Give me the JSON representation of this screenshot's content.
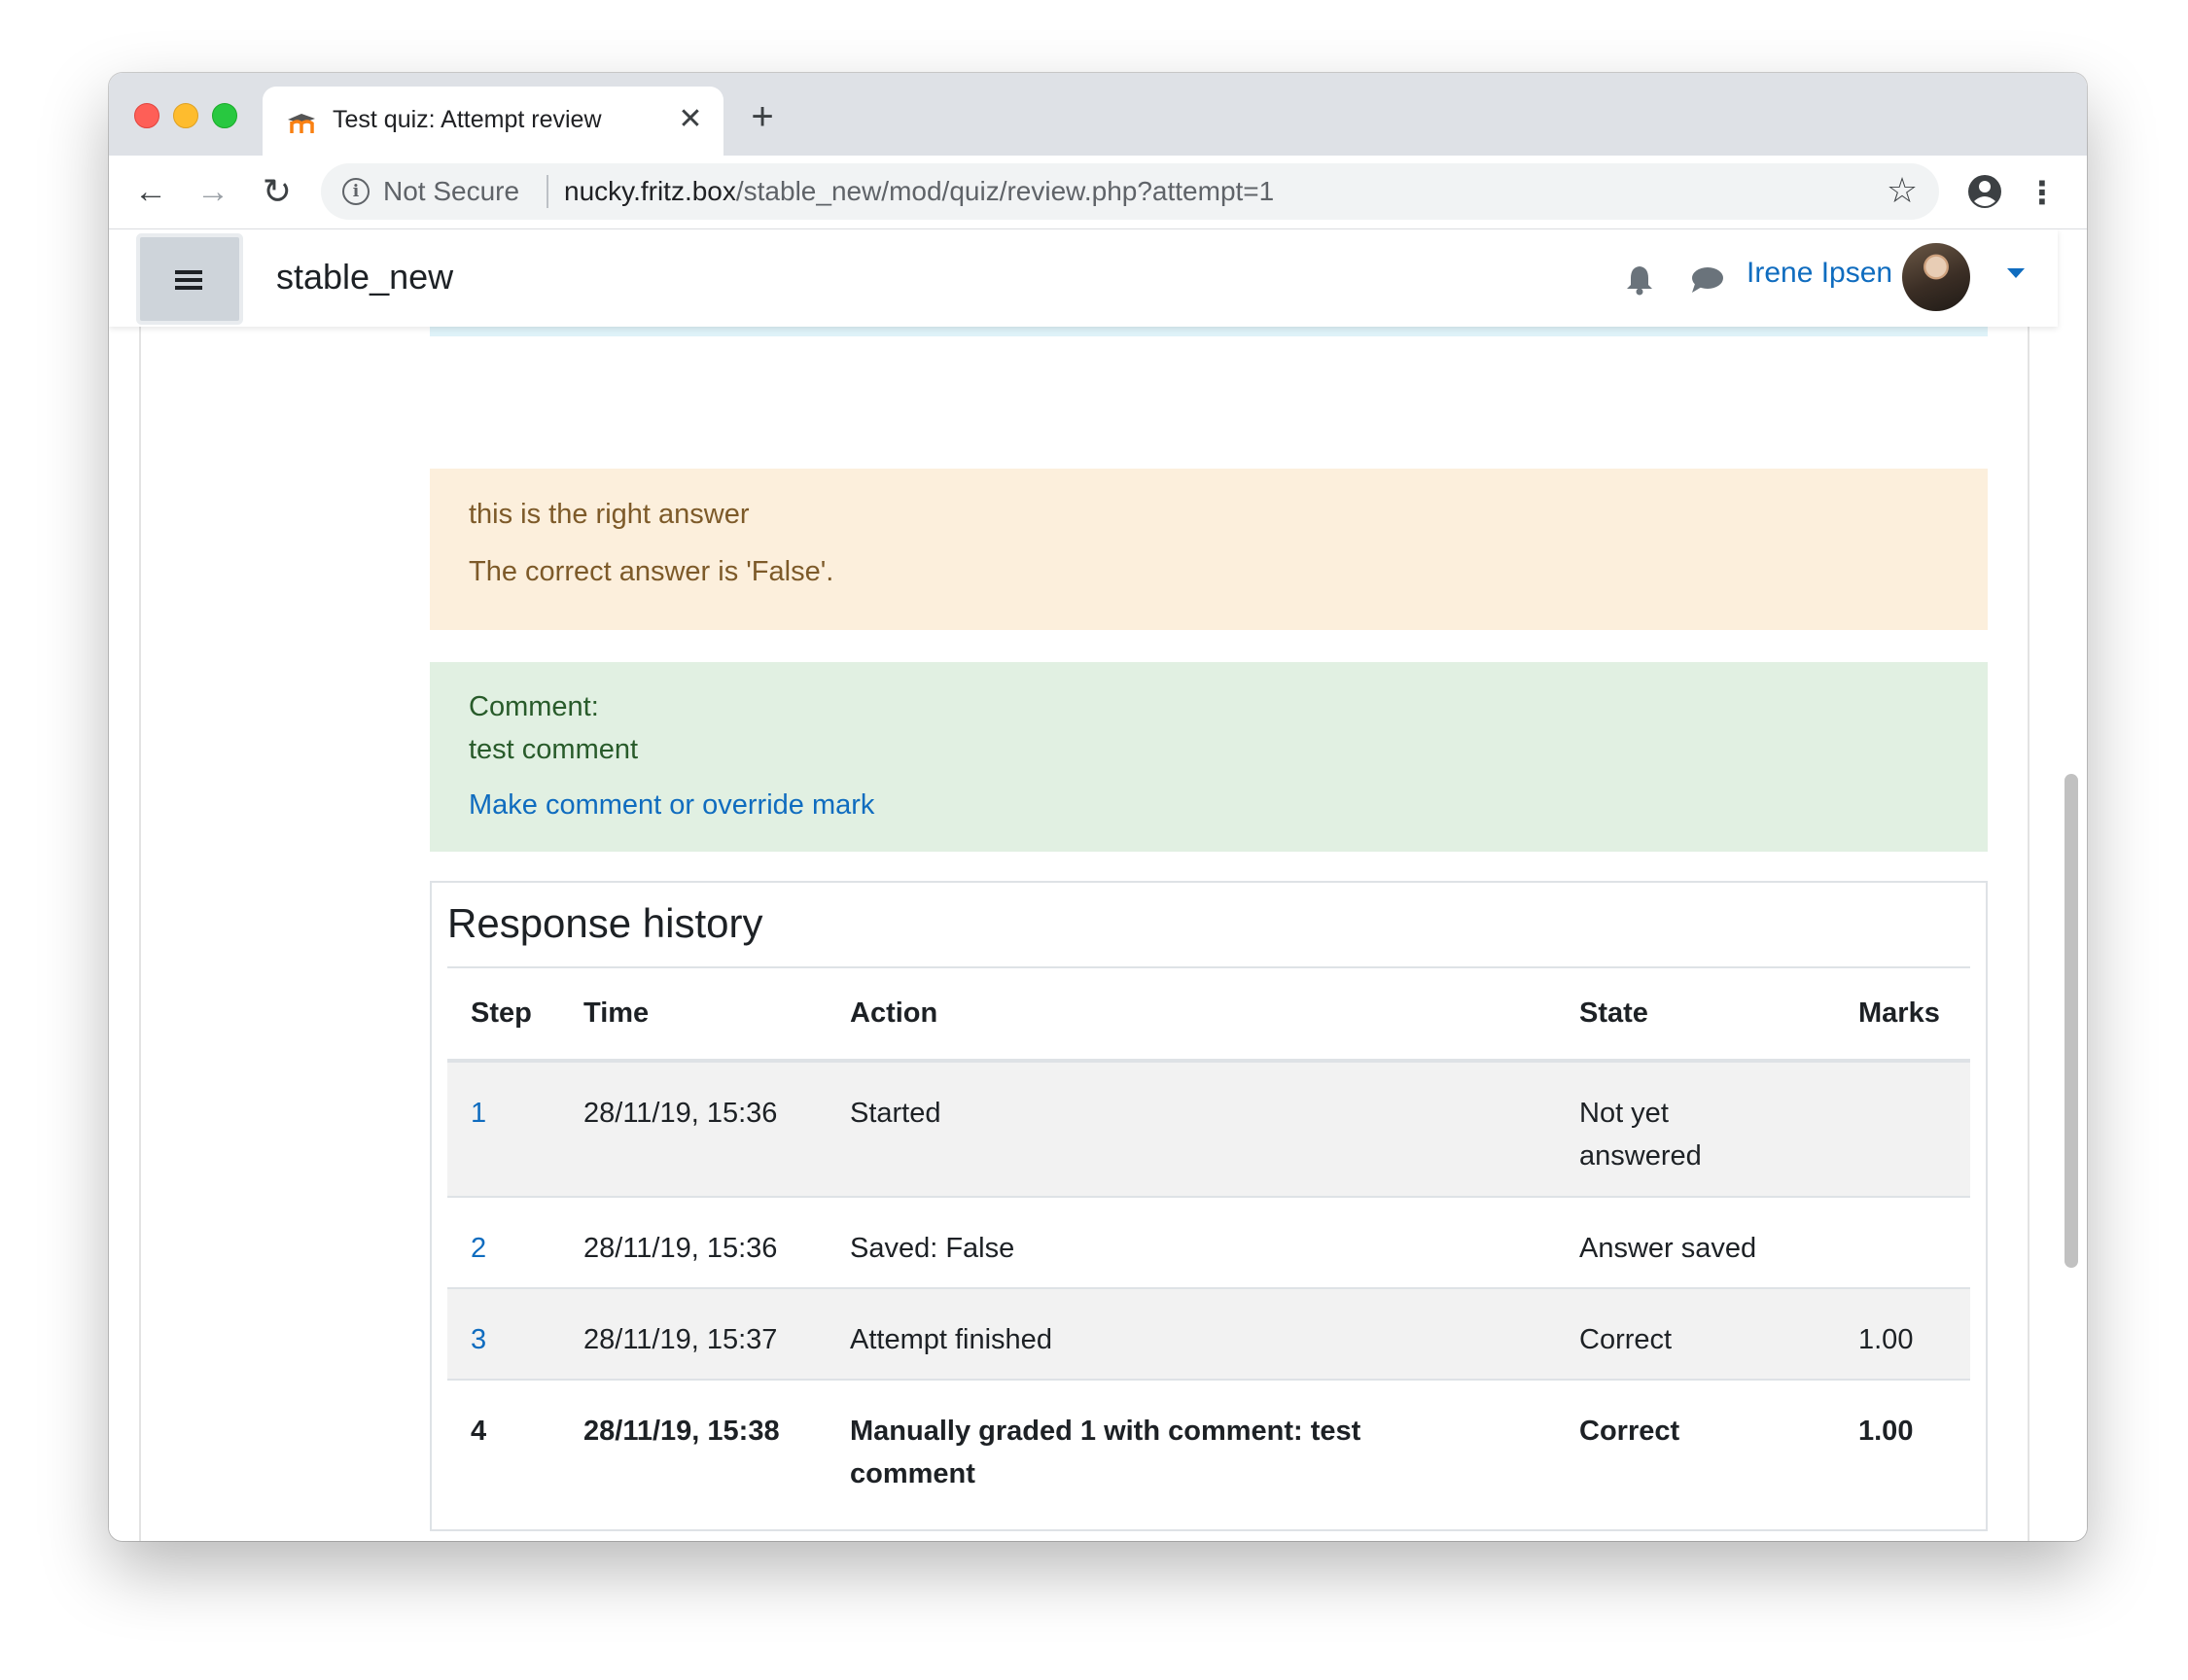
{
  "browser": {
    "tab_title": "Test quiz: Attempt review",
    "security_label": "Not Secure",
    "url_host": "nucky.fritz.box",
    "url_path": "/stable_new/mod/quiz/review.php?attempt=1"
  },
  "navbar": {
    "site_name": "stable_new",
    "user_name": "Irene Ipsen"
  },
  "feedback": {
    "specific": "this is the right answer",
    "correct_answer": "The correct answer is 'False'."
  },
  "comment": {
    "label": "Comment:",
    "text": "test comment",
    "link": "Make comment or override mark"
  },
  "history": {
    "title": "Response history",
    "headers": {
      "step": "Step",
      "time": "Time",
      "action": "Action",
      "state": "State",
      "marks": "Marks"
    },
    "rows": [
      {
        "step": "1",
        "time": "28/11/19, 15:36",
        "action": "Started",
        "state": "Not yet answered",
        "marks": ""
      },
      {
        "step": "2",
        "time": "28/11/19, 15:36",
        "action": "Saved: False",
        "state": "Answer saved",
        "marks": ""
      },
      {
        "step": "3",
        "time": "28/11/19, 15:37",
        "action": "Attempt finished",
        "state": "Correct",
        "marks": "1.00"
      },
      {
        "step": "4",
        "time": "28/11/19, 15:38",
        "action": "Manually graded 1 with comment: test comment",
        "state": "Correct",
        "marks": "1.00"
      }
    ]
  },
  "colors": {
    "link": "#0f6cbf",
    "feedback_bg": "#fcefdc",
    "comment_bg": "#e1f0e2",
    "info_bg": "#def2f8"
  }
}
